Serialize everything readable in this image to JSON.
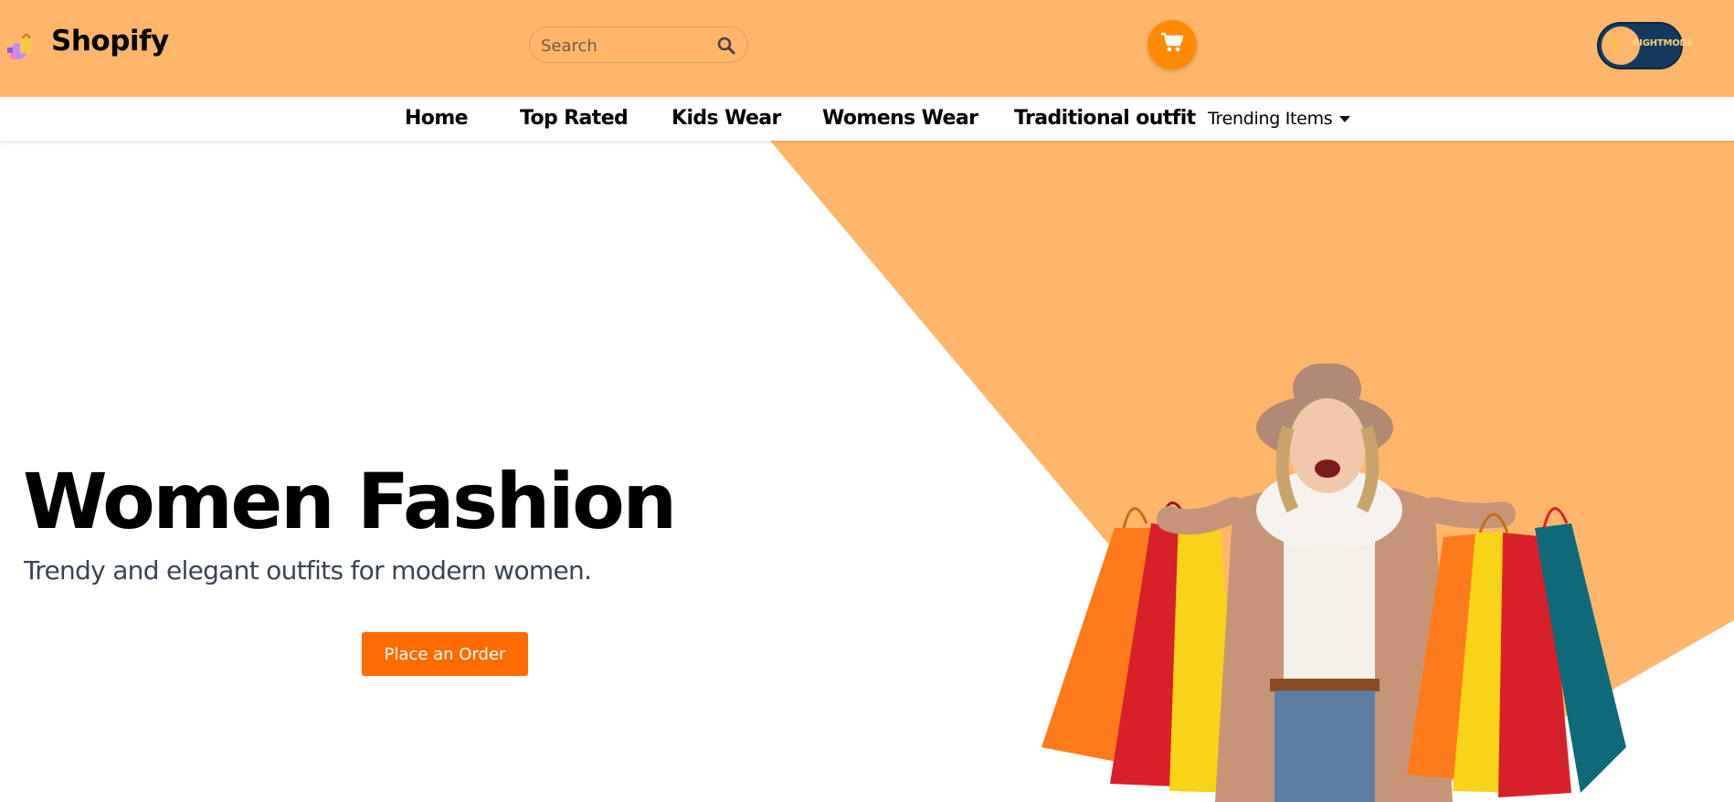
{
  "header": {
    "brand": "Shopify",
    "search": {
      "placeholder": "Search",
      "value": ""
    },
    "night_mode_label": "NIGHTMODE"
  },
  "nav": {
    "items": [
      "Home",
      "Top Rated",
      "Kids Wear",
      "Womens Wear",
      "Traditional outfit"
    ],
    "dropdown_label": "Trending Items"
  },
  "hero": {
    "title": "Women Fashion",
    "subtitle": "Trendy and elegant outfits for modern women.",
    "cta_label": "Place an Order"
  },
  "colors": {
    "accent": "#ffb66b",
    "cta": "#ff6b00",
    "cart": "#ff8a00",
    "night_toggle": "#133a5e"
  },
  "icons": [
    "shopping-logo-icon",
    "search-icon",
    "cart-icon",
    "moon-icon",
    "chevron-down-icon"
  ]
}
